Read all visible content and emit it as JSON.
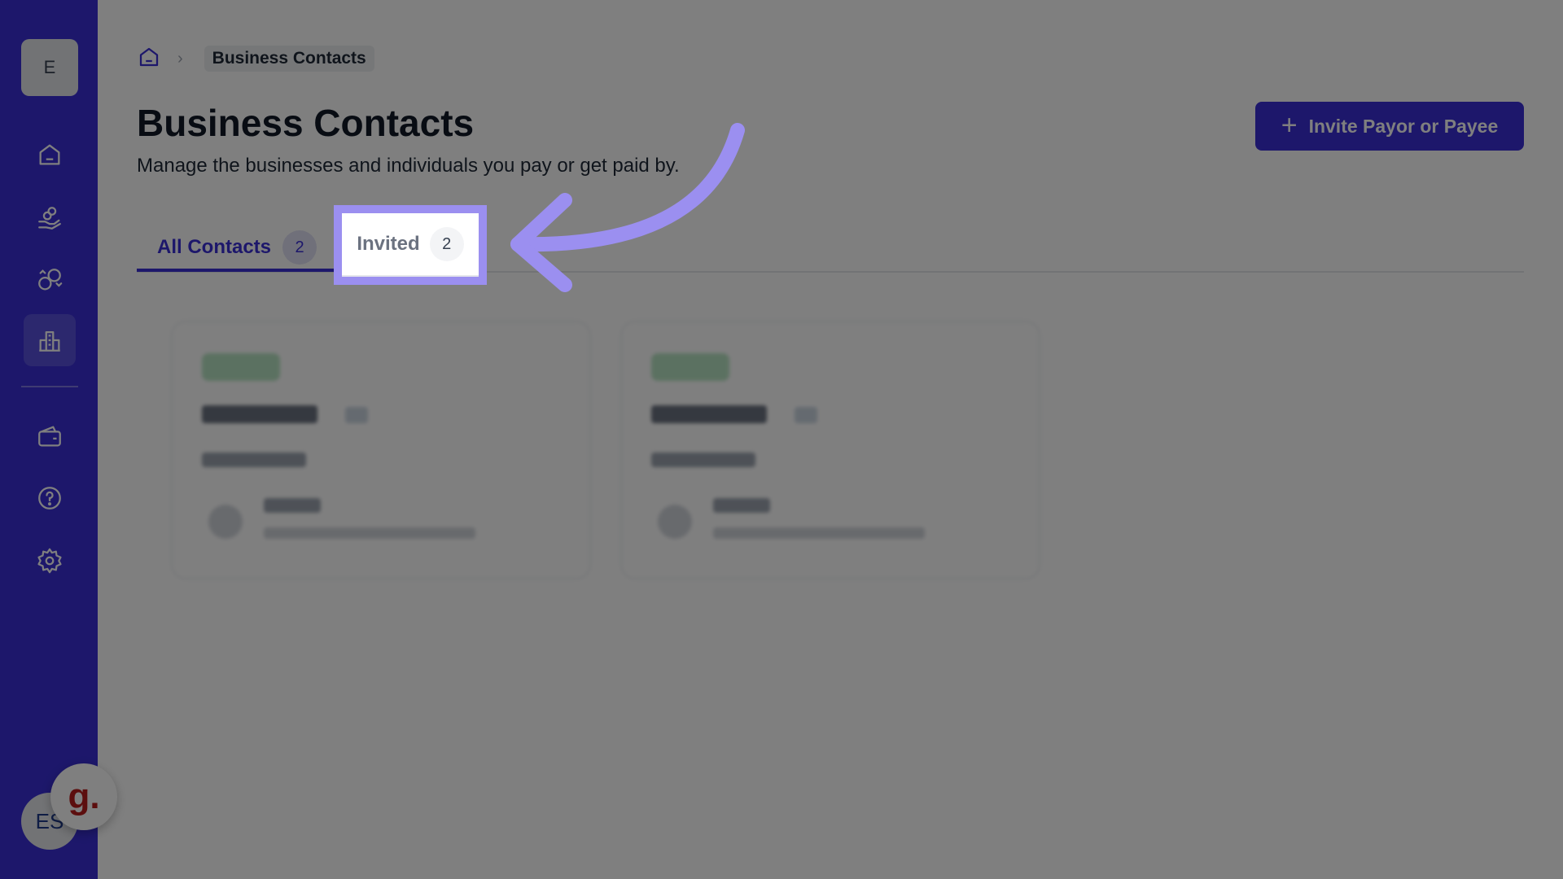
{
  "sidebar": {
    "org_initial": "E",
    "user_initials": "ES",
    "help_glyph": "g.",
    "items": [
      {
        "icon": "home-icon"
      },
      {
        "icon": "hand-coins-icon"
      },
      {
        "icon": "recurring-payments-icon"
      },
      {
        "icon": "building-icon",
        "active": true
      },
      {
        "icon": "wallet-icon"
      },
      {
        "icon": "help-circle-icon"
      },
      {
        "icon": "gear-icon"
      }
    ]
  },
  "breadcrumb": {
    "home_icon": "home-icon",
    "current": "Business Contacts"
  },
  "header": {
    "title": "Business Contacts",
    "subtitle": "Manage the businesses and individuals you pay or get paid by.",
    "invite_button": "Invite Payor or Payee",
    "invite_button_icon": "plus-icon"
  },
  "tabs": [
    {
      "label": "All Contacts",
      "count": "2",
      "active": true
    },
    {
      "label": "Invited",
      "count": "2",
      "highlighted": true
    }
  ],
  "colors": {
    "brand": "#3a2fd6",
    "highlight": "#9b8ff0",
    "overlay": "rgba(0,0,0,0.5)"
  }
}
